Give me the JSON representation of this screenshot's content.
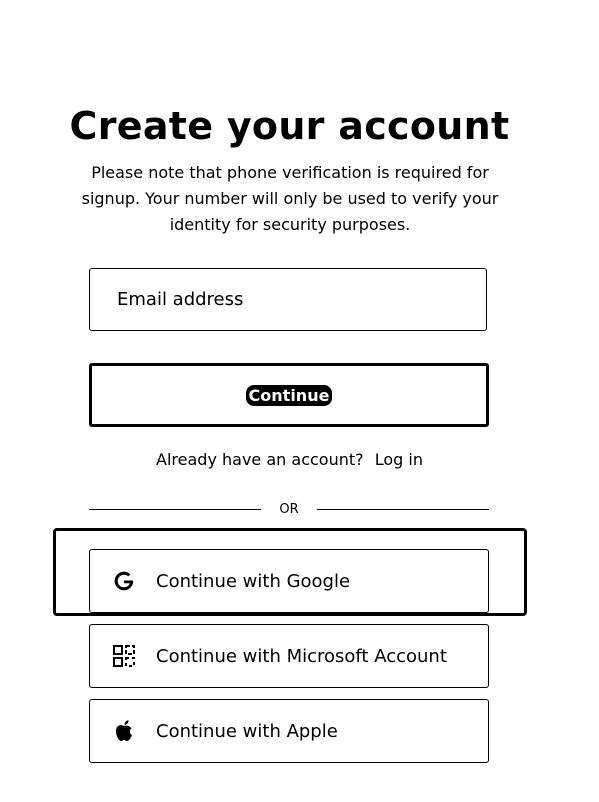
{
  "header": {
    "title": "Create your account",
    "subtitle": "Please note that phone verification is required for signup. Your number will only be used to verify your identity for security purposes."
  },
  "form": {
    "email_placeholder": "Email address",
    "email_value": "",
    "continue_label": "Continue"
  },
  "login": {
    "prompt": "Already have an account?",
    "link_label": "Log in"
  },
  "divider": {
    "label": "OR"
  },
  "social": [
    {
      "label": "Continue with Google",
      "icon": "google-icon"
    },
    {
      "label": "Continue with Microsoft Account",
      "icon": "microsoft-icon"
    },
    {
      "label": "Continue with Apple",
      "icon": "apple-icon"
    }
  ]
}
